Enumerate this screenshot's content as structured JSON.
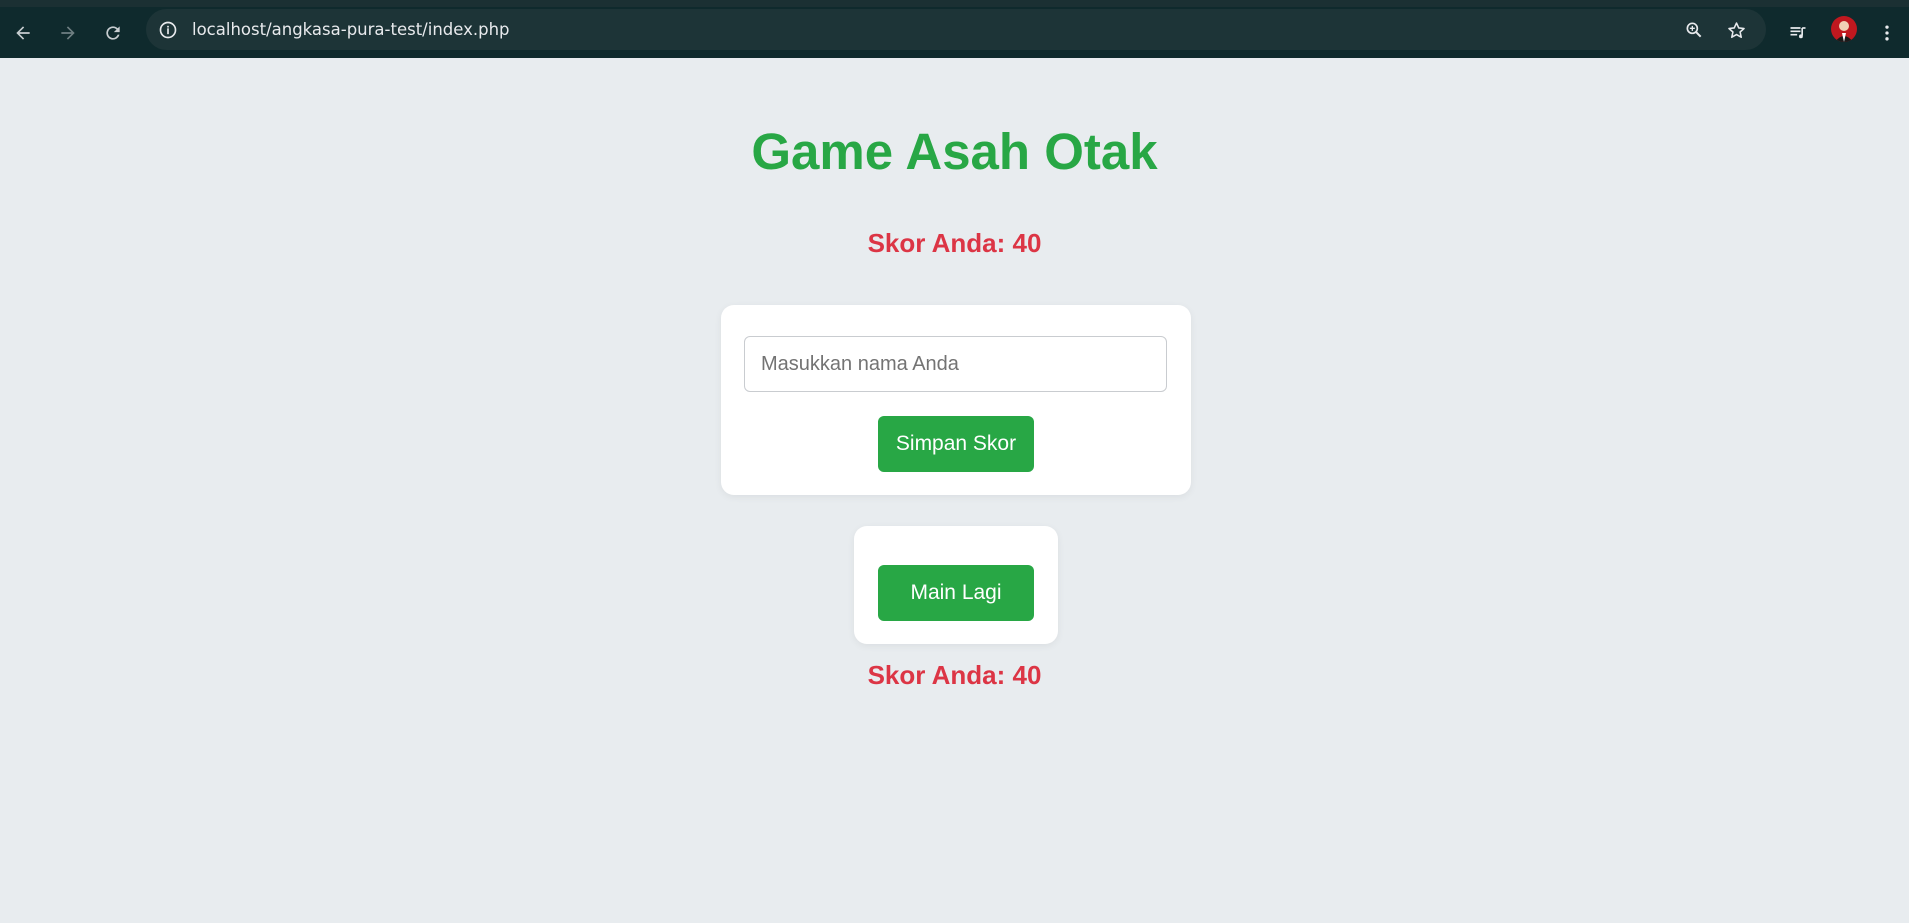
{
  "browser": {
    "url": "localhost/angkasa-pura-test/index.php",
    "icons": [
      "back-arrow-icon",
      "forward-arrow-icon",
      "reload-icon",
      "site-info-icon",
      "zoom-icon",
      "bookmark-star-icon",
      "media-queue-icon",
      "profile-avatar",
      "more-vert-icon"
    ]
  },
  "page": {
    "title": "Game Asah Otak",
    "score_top": "Skor Anda: 40",
    "name_input": {
      "placeholder": "Masukkan nama Anda",
      "value": ""
    },
    "save_button": "Simpan Skor",
    "play_again_button": "Main Lagi",
    "score_bottom": "Skor Anda: 40"
  },
  "colors": {
    "accent_green": "#28a745",
    "score_red": "#dc3545",
    "page_bg": "#e8ecef",
    "chrome_bg": "#0f2a2d"
  }
}
